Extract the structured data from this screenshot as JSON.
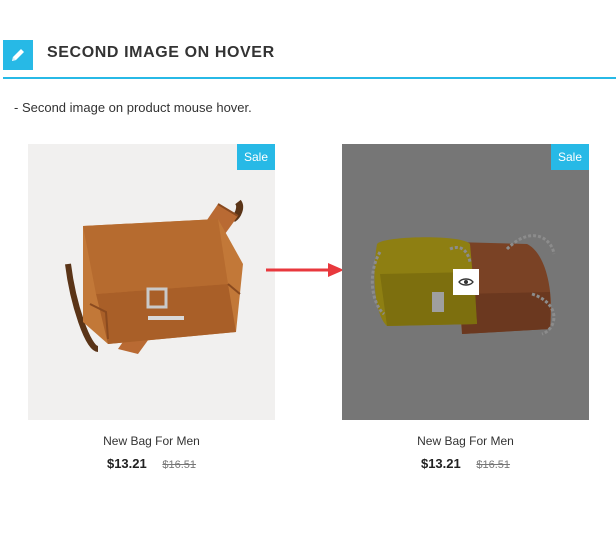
{
  "header": {
    "title": "SECOND IMAGE ON HOVER",
    "icon": "pencil-icon",
    "accent_color": "#27b9e6"
  },
  "description": "- Second image on product mouse hover.",
  "products": [
    {
      "state": "default",
      "badge": "Sale",
      "name": "New Bag For Men",
      "price": "$13.21",
      "old_price": "$16.51",
      "image": "brown-leather-messenger-bag"
    },
    {
      "state": "hover",
      "badge": "Sale",
      "name": "New Bag For Men",
      "price": "$13.21",
      "old_price": "$16.51",
      "image": "yellow-and-brown-chain-bags",
      "quick_view_icon": "eye-icon"
    }
  ],
  "arrow_color": "#e8383d"
}
